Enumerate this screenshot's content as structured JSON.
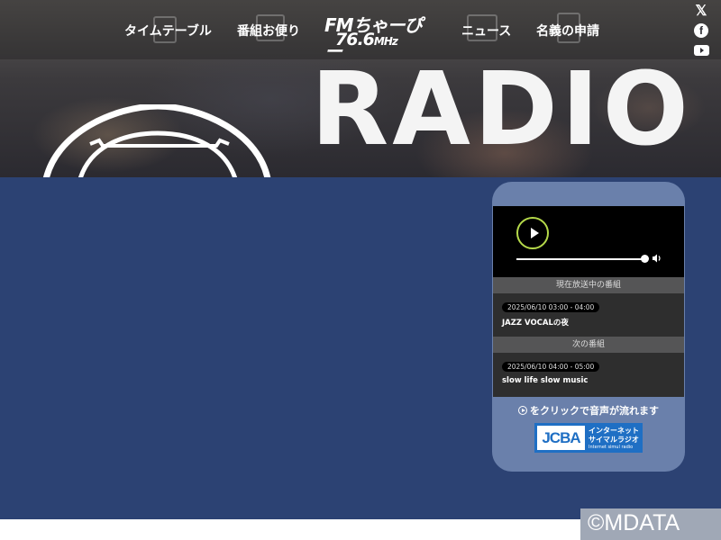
{
  "nav": {
    "items": [
      "タイムテーブル",
      "番組お便り",
      "ニュース",
      "名義の申請"
    ]
  },
  "logo": {
    "main": "FMちゃーぴー",
    "freq": "76.6",
    "unit": "MHz"
  },
  "social": [
    "x-icon",
    "facebook-icon",
    "youtube-icon"
  ],
  "hero": {
    "word": "RADIO"
  },
  "player": {
    "state": "paused",
    "progress": 1.0,
    "sections": {
      "now_label": "現在放送中の番組",
      "next_label": "次の番組"
    },
    "now": {
      "time": "2025/06/10 03:00 - 04:00",
      "title": "JAZZ VOCALの夜"
    },
    "next": {
      "time": "2025/06/10 04:00 - 05:00",
      "title": "slow life slow music"
    },
    "cta": "をクリックで音声が流れます"
  },
  "jcba": {
    "logo": "JCBA",
    "line1": "インターネット",
    "line2": "サイマルラジオ",
    "line3": "Internet simul radio"
  },
  "watermark": "©MDATA",
  "colors": {
    "main_bg": "#2c4273",
    "card_bg": "#6a80ab",
    "play_ring": "#b5d94a",
    "jcba": "#1f6fc4"
  }
}
